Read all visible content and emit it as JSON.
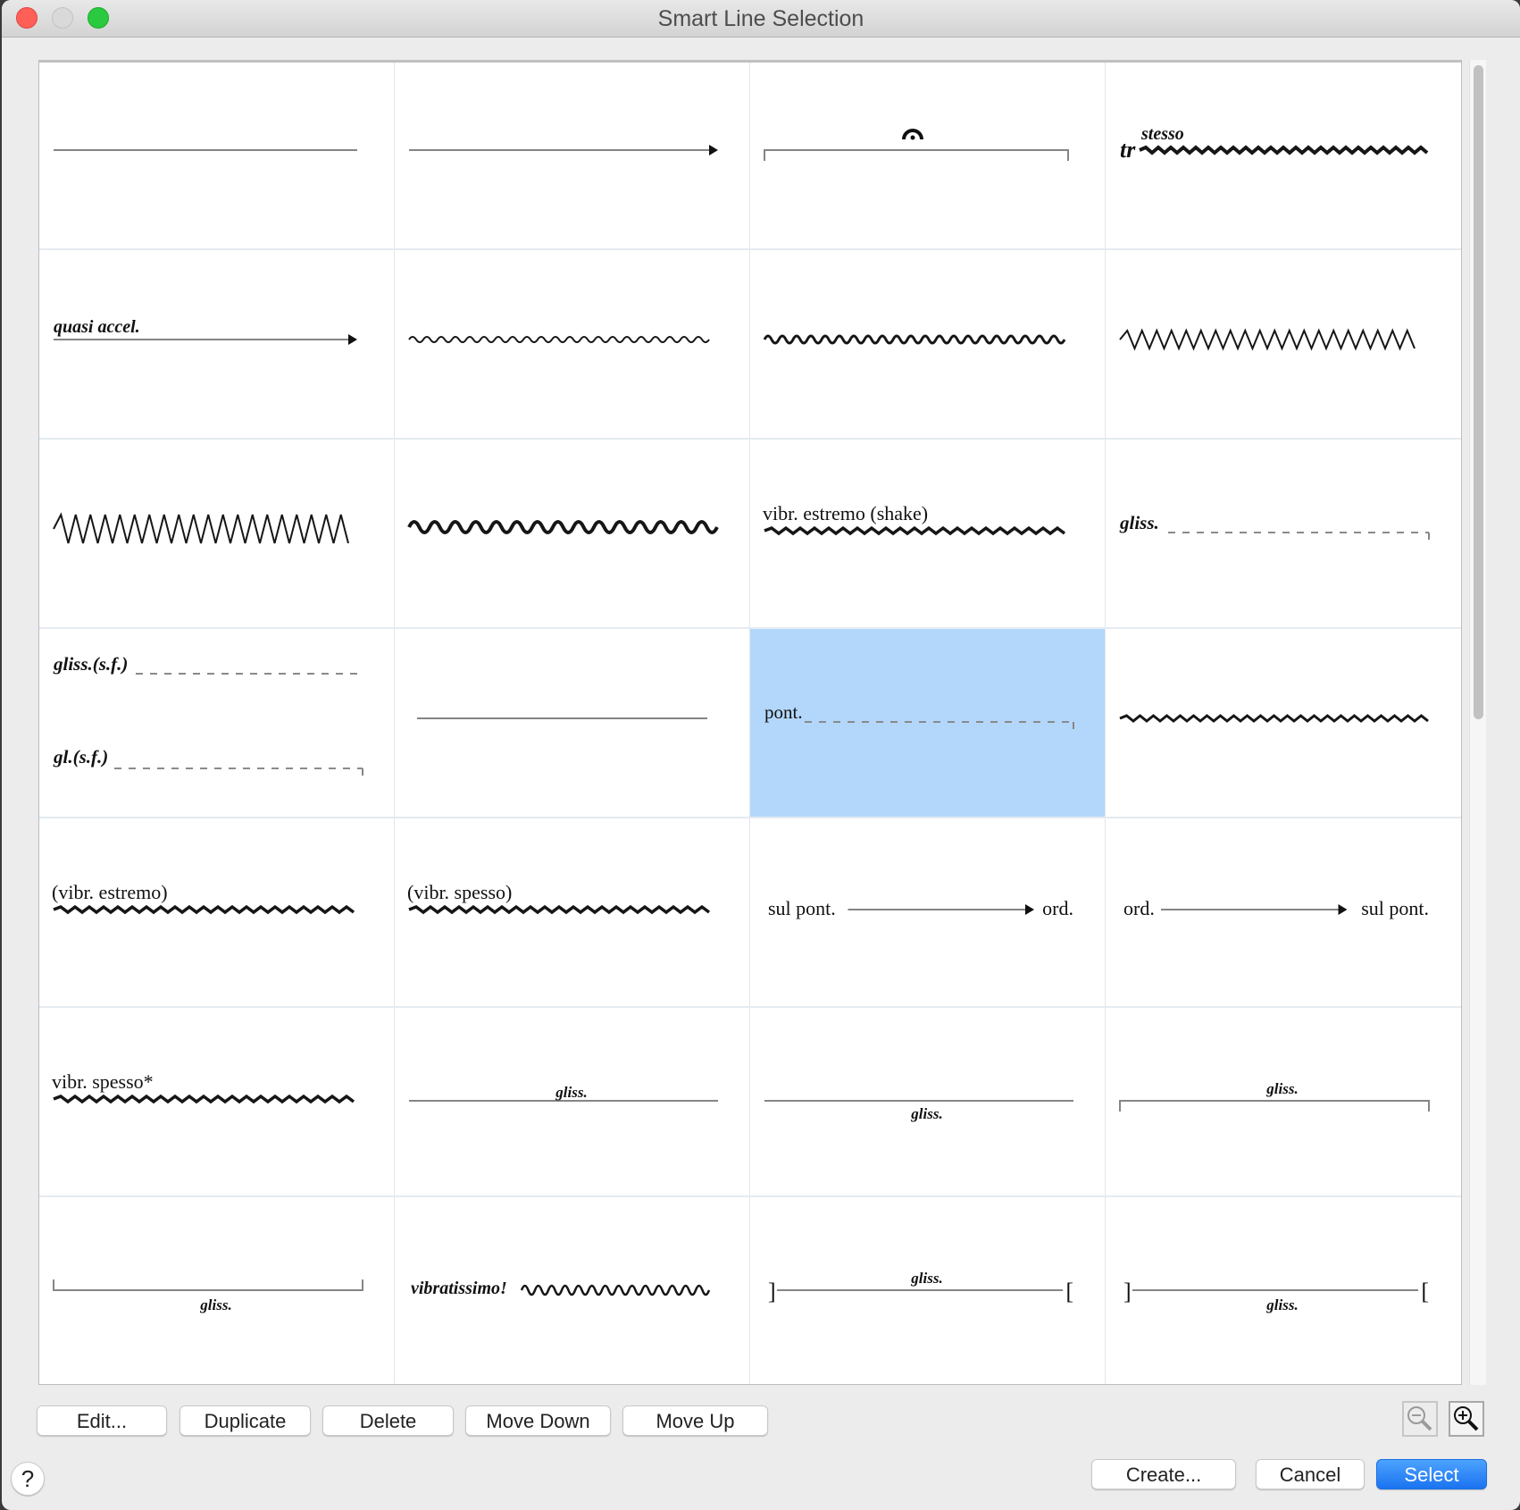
{
  "window": {
    "title": "Smart Line Selection"
  },
  "colors": {
    "selection": "#b3d7fb",
    "primary_button": "#1a73f0",
    "close": "#fe5f57",
    "maximize": "#29c940"
  },
  "grid": {
    "columns": 4,
    "selected_index": 14,
    "items": [
      {
        "style": "plain-line",
        "labels": []
      },
      {
        "style": "arrow-line",
        "labels": []
      },
      {
        "style": "bracket-with-fermata",
        "labels": [],
        "icon": "fermata-icon"
      },
      {
        "style": "trill-wavy",
        "labels": [
          "tr",
          "stesso"
        ]
      },
      {
        "style": "text-arrow",
        "labels": [
          "quasi accel."
        ]
      },
      {
        "style": "wavy-small",
        "labels": []
      },
      {
        "style": "wavy-medium",
        "labels": []
      },
      {
        "style": "wavy-zigzag",
        "labels": []
      },
      {
        "style": "wavy-zigzag-large",
        "labels": []
      },
      {
        "style": "wavy-wide",
        "labels": []
      },
      {
        "style": "text-wavy",
        "labels": [
          "vibr. estremo (shake)"
        ]
      },
      {
        "style": "text-dashed-hook",
        "labels": [
          "gliss."
        ]
      },
      {
        "style": "double-dashed",
        "labels": [
          "gliss.(s.f.)",
          "gl.(s.f.)"
        ]
      },
      {
        "style": "plain-line-short",
        "labels": []
      },
      {
        "style": "text-dashed-hook",
        "labels": [
          "pont."
        ]
      },
      {
        "style": "wavy-trill",
        "labels": []
      },
      {
        "style": "text-wavy",
        "labels": [
          "(vibr. estremo)"
        ]
      },
      {
        "style": "text-wavy",
        "labels": [
          "(vibr. spesso)"
        ]
      },
      {
        "style": "text-arrow-text",
        "labels": [
          "sul pont.",
          "ord."
        ]
      },
      {
        "style": "text-arrow-text",
        "labels": [
          "ord.",
          "sul pont."
        ]
      },
      {
        "style": "text-wavy",
        "labels": [
          "vibr. spesso*"
        ]
      },
      {
        "style": "line-text-above",
        "labels": [
          "gliss."
        ]
      },
      {
        "style": "line-text-below",
        "labels": [
          "gliss."
        ]
      },
      {
        "style": "bracket-down-text-above",
        "labels": [
          "gliss."
        ]
      },
      {
        "style": "bracket-up-text-below",
        "labels": [
          "gliss."
        ]
      },
      {
        "style": "text-wavy-inline",
        "labels": [
          "vibratissimo!"
        ]
      },
      {
        "style": "square-brackets-text-above",
        "labels": [
          "]",
          "gliss.",
          "["
        ]
      },
      {
        "style": "square-brackets-text-below",
        "labels": [
          "]",
          "gliss.",
          "["
        ]
      }
    ]
  },
  "toolbar": {
    "edit": "Edit...",
    "duplicate": "Duplicate",
    "delete": "Delete",
    "move_down": "Move Down",
    "move_up": "Move Up"
  },
  "zoom_controls": {
    "zoom_out_icon": "zoom-out-icon",
    "zoom_in_icon": "zoom-in-icon"
  },
  "footer": {
    "help": "?",
    "create": "Create...",
    "cancel": "Cancel",
    "select": "Select"
  }
}
